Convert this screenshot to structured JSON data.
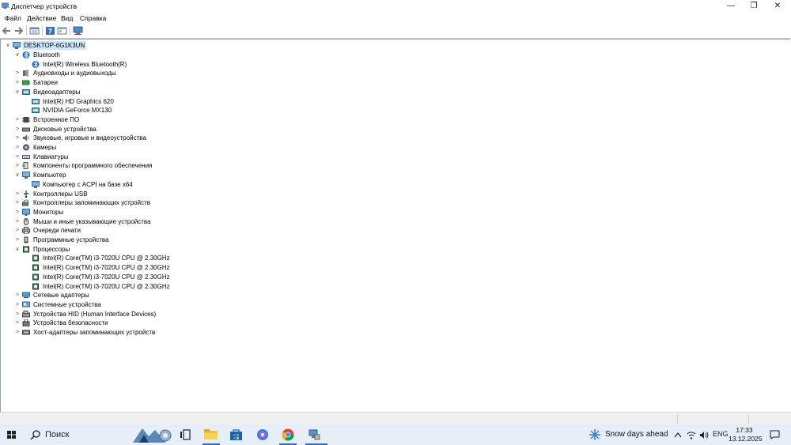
{
  "window": {
    "title": "Диспетчер устройств",
    "controls": {
      "minimize": "—",
      "maximize": "❐",
      "close": "✕"
    }
  },
  "menu": [
    "Файл",
    "Действие",
    "Вид",
    "Справка"
  ],
  "tree": {
    "root": "DESKTOP-6G1K3UN",
    "items": [
      {
        "level": 1,
        "expander": "∨",
        "icon": "bluetooth-icon",
        "label": "Bluetooth"
      },
      {
        "level": 2,
        "expander": "",
        "icon": "bluetooth-icon",
        "label": "Intel(R) Wireless Bluetooth(R)"
      },
      {
        "level": 1,
        "expander": ">",
        "icon": "audio-icon",
        "label": "Аудиовходы и аудиовыходы"
      },
      {
        "level": 1,
        "expander": ">",
        "icon": "battery-icon",
        "label": "Батареи"
      },
      {
        "level": 1,
        "expander": "∨",
        "icon": "display-adapter-icon",
        "label": "Видеоадаптеры"
      },
      {
        "level": 2,
        "expander": "",
        "icon": "display-adapter-icon",
        "label": "Intel(R) HD Graphics 620"
      },
      {
        "level": 2,
        "expander": "",
        "icon": "display-adapter-icon",
        "label": "NVIDIA GeForce MX130"
      },
      {
        "level": 1,
        "expander": ">",
        "icon": "firmware-icon",
        "label": "Встроенное ПО"
      },
      {
        "level": 1,
        "expander": ">",
        "icon": "disk-icon",
        "label": "Дисковые устройства"
      },
      {
        "level": 1,
        "expander": ">",
        "icon": "sound-icon",
        "label": "Звуковые, игровые и видеоустройства"
      },
      {
        "level": 1,
        "expander": ">",
        "icon": "camera-icon",
        "label": "Камеры"
      },
      {
        "level": 1,
        "expander": ">",
        "icon": "keyboard-icon",
        "label": "Клавиатуры"
      },
      {
        "level": 1,
        "expander": ">",
        "icon": "software-component-icon",
        "label": "Компоненты программного обеспечения"
      },
      {
        "level": 1,
        "expander": "∨",
        "icon": "computer-icon",
        "label": "Компьютер"
      },
      {
        "level": 2,
        "expander": "",
        "icon": "computer-icon",
        "label": "Компьютер с ACPI на базе x64"
      },
      {
        "level": 1,
        "expander": ">",
        "icon": "usb-icon",
        "label": "Контроллеры USB"
      },
      {
        "level": 1,
        "expander": ">",
        "icon": "storage-controller-icon",
        "label": "Контроллеры запоминающих устройств"
      },
      {
        "level": 1,
        "expander": ">",
        "icon": "monitor-icon",
        "label": "Мониторы"
      },
      {
        "level": 1,
        "expander": ">",
        "icon": "mouse-icon",
        "label": "Мыши и иные указывающие устройства"
      },
      {
        "level": 1,
        "expander": ">",
        "icon": "printer-icon",
        "label": "Очереди печати"
      },
      {
        "level": 1,
        "expander": ">",
        "icon": "software-device-icon",
        "label": "Программные устройства"
      },
      {
        "level": 1,
        "expander": "∨",
        "icon": "processor-icon",
        "label": "Процессоры"
      },
      {
        "level": 2,
        "expander": "",
        "icon": "processor-icon",
        "label": "Intel(R) Core(TM) i3-7020U CPU @ 2.30GHz"
      },
      {
        "level": 2,
        "expander": "",
        "icon": "processor-icon",
        "label": "Intel(R) Core(TM) i3-7020U CPU @ 2.30GHz"
      },
      {
        "level": 2,
        "expander": "",
        "icon": "processor-icon",
        "label": "Intel(R) Core(TM) i3-7020U CPU @ 2.30GHz"
      },
      {
        "level": 2,
        "expander": "",
        "icon": "processor-icon",
        "label": "Intel(R) Core(TM) i3-7020U CPU @ 2.30GHz"
      },
      {
        "level": 1,
        "expander": ">",
        "icon": "network-adapter-icon",
        "label": "Сетевые адаптеры"
      },
      {
        "level": 1,
        "expander": ">",
        "icon": "system-device-icon",
        "label": "Системные устройства"
      },
      {
        "level": 1,
        "expander": ">",
        "icon": "hid-icon",
        "label": "Устройства HID (Human Interface Devices)"
      },
      {
        "level": 1,
        "expander": ">",
        "icon": "security-device-icon",
        "label": "Устройства безопасности"
      },
      {
        "level": 1,
        "expander": ">",
        "icon": "host-adapter-icon",
        "label": "Хост-адаптеры запоминающих устройств"
      }
    ]
  },
  "taskbar": {
    "search_label": "Поиск",
    "weather": "Snow days ahead",
    "language": "ENG",
    "time": "17:33",
    "date": "13.12.2025"
  },
  "colors": {
    "selection": "#cde8ff",
    "taskbar": "#e6eef7",
    "accent": "#2a6fd6"
  }
}
